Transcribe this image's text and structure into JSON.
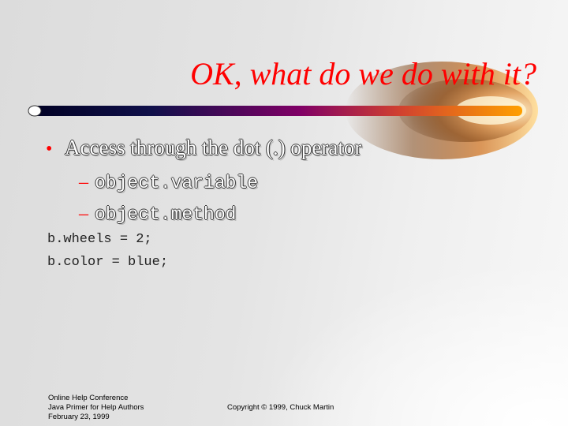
{
  "slide": {
    "title": "OK, what do we do with it?",
    "bullets": [
      {
        "marker": "•",
        "text": "Access through the dot (.) operator",
        "sub": [
          {
            "marker": "–",
            "text": "object.variable"
          },
          {
            "marker": "–",
            "text": "object.method"
          }
        ]
      }
    ],
    "code_lines": [
      "b.wheels = 2;",
      "b.color = blue;"
    ]
  },
  "footer": {
    "left_lines": [
      "Online Help Conference",
      "Java Primer for Help Authors",
      "February 23, 1999"
    ],
    "center": "Copyright © 1999, Chuck Martin"
  },
  "colors": {
    "title": "#ff0000",
    "bar_start": "#000033",
    "bar_mid": "#800066",
    "bar_end": "#ff9900"
  }
}
